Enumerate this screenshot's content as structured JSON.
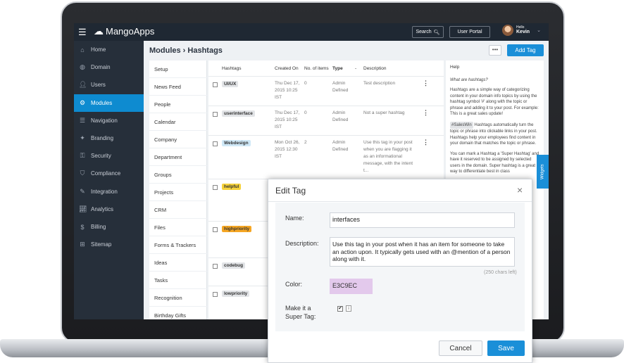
{
  "topbar": {
    "logo": "MangoApps",
    "search_label": "Search",
    "portal_label": "User Portal",
    "hello": "Hello",
    "user_name": "Kevin"
  },
  "sidebar": {
    "items": [
      {
        "label": "Home",
        "icon": "home-icon"
      },
      {
        "label": "Domain",
        "icon": "globe-icon"
      },
      {
        "label": "Users",
        "icon": "user-icon"
      },
      {
        "label": "Modules",
        "icon": "modules-icon"
      },
      {
        "label": "Navigation",
        "icon": "list-icon"
      },
      {
        "label": "Branding",
        "icon": "bird-icon"
      },
      {
        "label": "Security",
        "icon": "key-icon"
      },
      {
        "label": "Compliance",
        "icon": "shield-icon"
      },
      {
        "label": "Integration",
        "icon": "wrench-icon"
      },
      {
        "label": "Analytics",
        "icon": "chart-icon"
      },
      {
        "label": "Billing",
        "icon": "dollar-icon"
      },
      {
        "label": "Sitemap",
        "icon": "sitemap-icon"
      }
    ],
    "active_index": 3
  },
  "main": {
    "title": "Modules › Hashtags",
    "more_label": "•••",
    "add_label": "Add Tag"
  },
  "submenu": [
    "Setup",
    "News Feed",
    "People",
    "Calendar",
    "Company",
    "Department",
    "Groups",
    "Projects",
    "CRM",
    "Files",
    "Forms & Trackers",
    "Ideas",
    "Tasks",
    "Recognition",
    "Birthday Gifts"
  ],
  "table": {
    "headers": {
      "hashtags": "Hashtags",
      "created": "Created On",
      "items": "No. of items",
      "type": "Type",
      "type_sort": "-",
      "description": "Description"
    },
    "rows": [
      {
        "tag": "UI/UX",
        "color": "#e2e4e7",
        "created": "Thu Dec 17, 2015 10:25 IST",
        "items": "0",
        "type": "Admin Defined",
        "description": "Test description"
      },
      {
        "tag": "userinterface",
        "color": "#e2e4e7",
        "created": "Thu Dec 17, 2015 10:25 IST",
        "items": "0",
        "type": "Admin Defined",
        "description": "Not a super hashtag"
      },
      {
        "tag": "Webdesign",
        "color": "#cfe8f7",
        "created": "Mon Oct 26, 2015 12:30 IST",
        "items": "2",
        "type": "Admin Defined",
        "description": "Use this tag in your post when you are flagging it as an informational message, with the intent t..."
      },
      {
        "tag": "helpful",
        "color": "#f6d23b",
        "created": "",
        "items": "",
        "type": "",
        "description": ""
      },
      {
        "tag": "highpriority",
        "color": "#f5a623",
        "created": "",
        "items": "",
        "type": "",
        "description": ""
      },
      {
        "tag": "codebug",
        "color": "#e2e4e7",
        "created": "",
        "items": "",
        "type": "",
        "description": ""
      },
      {
        "tag": "lowpriority",
        "color": "#e2e4e7",
        "created": "",
        "items": "",
        "type": "",
        "description": ""
      }
    ]
  },
  "help": {
    "title": "Help",
    "q1": "What are hashtags?",
    "p1": "Hashtags are a simple way of categorizing content in your domain info topics by using the hashtag symbol '#' along with the topic or phrase and adding it to your post. For example: This is a great sales update!",
    "chip": "#SalesWin",
    "p2": "Hashtags automatically turn the topic or phrase into clickable links in your post. Hashtags help your employees find content in your domain that matches the topic or phrase.",
    "p3": "You can mark a Hashtag a 'Super Hashtag' and have it reserved to be assigned by selected users in the domain. Super hashtag is a great way to differentiate best in class"
  },
  "widgets_label": "Widgets",
  "modal": {
    "title": "Edit Tag",
    "close": "×",
    "name_label": "Name:",
    "name_value": "interfaces",
    "description_label": "Description:",
    "description_value": "Use this tag in your post when it has an item for someone to take an action upon. It typically gets used with an @mention of a person along with it.",
    "chars_left": "(250 chars left)",
    "color_label": "Color:",
    "color_value": "E3C9EC",
    "super_label": "Make it a Super Tag:",
    "super_checked": "✔",
    "info": "i",
    "cancel_label": "Cancel",
    "save_label": "Save"
  }
}
